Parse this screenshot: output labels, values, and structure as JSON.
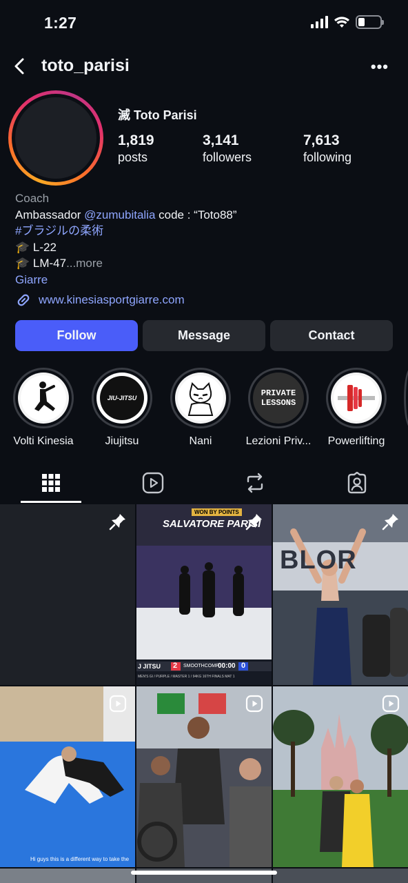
{
  "status_bar": {
    "time": "1:27",
    "battery_level": 0.3
  },
  "header": {
    "username": "toto_parisi",
    "back_icon": "chevron-left-icon",
    "menu_icon": "more-horizontal-icon",
    "menu_label": "•••"
  },
  "profile": {
    "display_name": "滅 Toto Parisi",
    "stats": [
      {
        "value": "1,819",
        "label": "posts"
      },
      {
        "value": "3,141",
        "label": "followers"
      },
      {
        "value": "7,613",
        "label": "following"
      }
    ],
    "category": "Coach",
    "bio": {
      "line1_prefix": "Ambassador ",
      "line1_mention": "@zumubitalia",
      "line1_suffix": " code : “Toto88”",
      "hashtag": "#ブラジルの柔術",
      "line3": "🎓 L-22",
      "line4": "🎓 LM-47",
      "more_ellipsis": "...",
      "more": "more",
      "location": "Giarre"
    },
    "website": "www.kinesiasportgiarre.com"
  },
  "actions": {
    "follow": "Follow",
    "message": "Message",
    "contact": "Contact"
  },
  "highlights": [
    {
      "label": "Volti Kinesia"
    },
    {
      "label": "Jiujitsu",
      "img_text": "JIU-JITSU"
    },
    {
      "label": "Nani"
    },
    {
      "label": "Lezioni Priv...",
      "img_text1": "PRIVATE",
      "img_text2": "LESSONS"
    },
    {
      "label": "Powerlifting"
    }
  ],
  "tabs": [
    {
      "name": "grid",
      "icon": "grid-icon",
      "active": true
    },
    {
      "name": "reels",
      "icon": "reels-icon",
      "active": false
    },
    {
      "name": "reposts",
      "icon": "repost-icon",
      "active": false
    },
    {
      "name": "tagged",
      "icon": "tagged-person-icon",
      "active": false
    }
  ],
  "posts": [
    {
      "badge": "pin-icon"
    },
    {
      "badge": "pin-icon",
      "top_tag": "WON BY POINTS",
      "title": "SALVATORE PARISI",
      "score_left_label": "J JITSU",
      "score_left": "2",
      "brand": "SMOOTHCOMP",
      "timer": "00:00",
      "score_right": "0",
      "subtext": "MEN'S GI / PURPLE / MASTER 1 / 94KG     16TH FINALS     MAT 1"
    },
    {
      "badge": "pin-icon",
      "banner": "BLOR"
    },
    {
      "badge": "reel-icon",
      "caption": "Hi guys this is a different way to take the"
    },
    {
      "badge": "reel-icon"
    },
    {
      "badge": "reel-icon"
    }
  ],
  "colors": {
    "accent": "#4a5df9",
    "link": "#8fa6ff",
    "background": "#0b0e14",
    "button": "#26292f"
  }
}
